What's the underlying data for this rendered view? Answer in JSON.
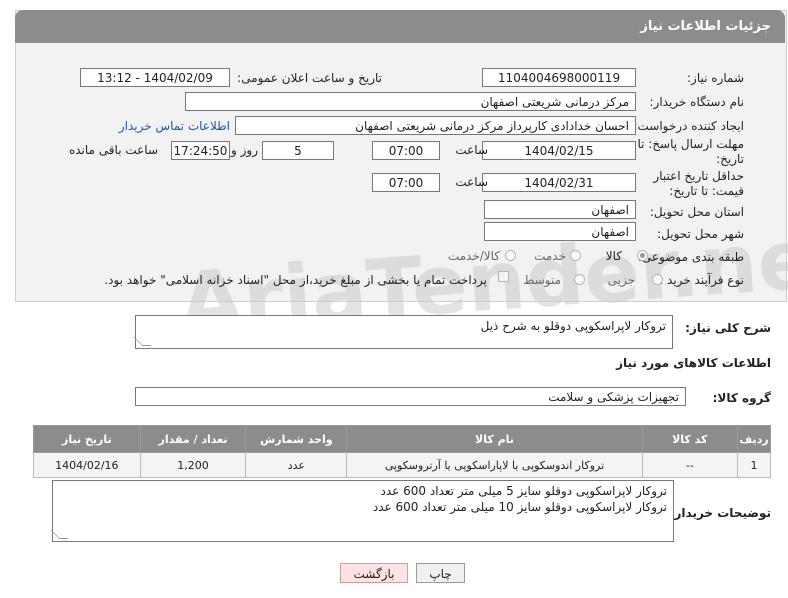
{
  "header": {
    "title": "جزئیات اطلاعات نیاز"
  },
  "form": {
    "need_number_label": "شماره نیاز:",
    "need_number": "1104004698000119",
    "announce_label": "تاریخ و ساعت اعلان عمومی:",
    "announce_value": "1404/02/09 - 13:12",
    "buyer_org_label": "نام دستگاه خریدار:",
    "buyer_org": "مرکز درمانی شریعتی اصفهان",
    "creator_label": "ایجاد کننده درخواست:",
    "creator": "احسان خدادادی کارپرداز مرکز درمانی شریعتی اصفهان",
    "contact_link": "اطلاعات تماس خریدار",
    "reply_deadline_label": "مهلت ارسال پاسخ: تا تاریخ:",
    "reply_date": "1404/02/15",
    "time_label": "ساعت",
    "reply_time": "07:00",
    "days_value": "5",
    "days_label": "روز و",
    "remaining_time": "17:24:50",
    "remaining_label": "ساعت باقی مانده",
    "price_validity_label": "حداقل تاریخ اعتبار قیمت: تا تاریخ:",
    "price_date": "1404/02/31",
    "price_time": "07:00",
    "province_label": "استان محل تحویل:",
    "province": "اصفهان",
    "city_label": "شهر محل تحویل:",
    "city": "اصفهان",
    "category_label": "طبقه بندی موضوعی:",
    "category_options": [
      "کالا",
      "خدمت",
      "کالا/خدمت"
    ],
    "category_selected": "کالا",
    "process_label": "نوع فرآیند خرید :",
    "process_options": [
      "جزیی",
      "متوسط"
    ],
    "payment_note": "پرداخت تمام یا بخشی از مبلغ خرید،از محل \"اسناد خزانه اسلامی\" خواهد بود."
  },
  "description": {
    "label": "شرح کلی نیاز:",
    "text": "تروکار لاپراسکوپی دوقلو به شرح ذیل"
  },
  "goods": {
    "section_title": "اطلاعات کالاهای مورد نیاز",
    "group_label": "گروه کالا:",
    "group_value": "تجهیزات پزشکی و سلامت",
    "columns": [
      "ردیف",
      "کد کالا",
      "نام کالا",
      "واحد شمارش",
      "تعداد / مقدار",
      "تاریخ نیاز"
    ],
    "rows": [
      [
        "1",
        "--",
        "تروکار اندوسکوپی یا لاپاراسکوپی یا آرتروسکوپی",
        "عدد",
        "1,200",
        "1404/02/16"
      ]
    ]
  },
  "buyer_notes": {
    "label": "توضیحات خریدار:",
    "line1": "تروکار لاپراسکوپی دوقلو سایز 5 میلی متر تعداد 600 عدد",
    "line2": "تروکار لاپراسکوپی دوقلو سایز 10 میلی متر تعداد 600 عدد"
  },
  "buttons": {
    "print": "چاپ",
    "back": "بازگشت"
  },
  "watermark": "AriaTender.neT"
}
